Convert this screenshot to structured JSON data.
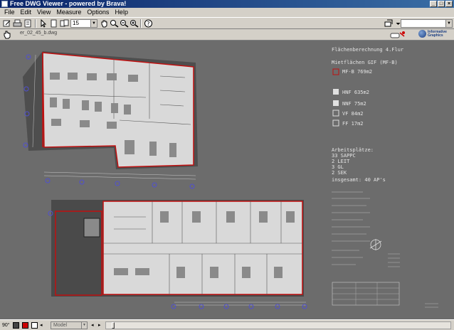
{
  "window": {
    "title": "Free DWG Viewer - powered by Brava!"
  },
  "menu": [
    "File",
    "Edit",
    "View",
    "Measure",
    "Options",
    "Help"
  ],
  "toolbar": {
    "zoom_value": "15"
  },
  "document": {
    "filename": "er_02_45_b.dwg"
  },
  "logo": {
    "line1": "Informative",
    "line2": "Graphics"
  },
  "legend": {
    "title": "Flächenberechnung 4.Flur",
    "gif_heading": "Mietflächen GIF (MF-B)",
    "mfb": "MF-B   769m2",
    "hnf": "HNF  635m2",
    "nnf": "NNF    75m2",
    "vf": "VF      84m2",
    "ff": "FF      17m2",
    "workplaces_heading": "Arbeitsplätze:",
    "wp_rows": [
      "33     SAPPC",
      "2       LEIT",
      "3       GL",
      "2       SEK"
    ],
    "total": "insgesamt: 40 AP's"
  },
  "statusbar": {
    "angle": "90°",
    "layout": "Model"
  },
  "colors": {
    "canvas": "#6c6c6c",
    "wall": "#c01010",
    "floor": "#d9d9d9",
    "marker": "#4040c0",
    "titlebar": "#0a246a"
  }
}
